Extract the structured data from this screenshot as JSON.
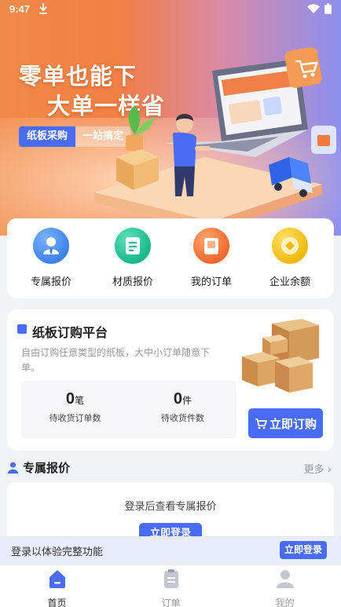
{
  "status_bar": {
    "time": "9:47"
  },
  "banner": {
    "slogan_line1": "零单也能下",
    "slogan_line2": "大单一样省",
    "tag_primary": "纸板采购",
    "tag_secondary": "一站搞定"
  },
  "quick_menu": [
    {
      "label": "专属报价",
      "icon": "user-badge-icon",
      "color": "#3f82ee"
    },
    {
      "label": "材质报价",
      "icon": "document-icon",
      "color": "#19b88a"
    },
    {
      "label": "我的订单",
      "icon": "order-icon",
      "color": "#f2692e"
    },
    {
      "label": "企业余额",
      "icon": "coin-icon",
      "color": "#f2b90c"
    }
  ],
  "platform": {
    "title": "纸板订购平台",
    "description": "自由订购任意类型的纸板，大中小订单随意下单。",
    "stats": [
      {
        "value": "0",
        "unit": "笔",
        "label": "待收货订单数"
      },
      {
        "value": "0",
        "unit": "件",
        "label": "待收货件数"
      }
    ],
    "order_button": "立即订购"
  },
  "exclusive_quote": {
    "title": "专属报价",
    "more": "更多",
    "hint": "登录后查看专属报价",
    "login_button": "立即登录"
  },
  "login_bar": {
    "text": "登录以体验完整功能",
    "button": "立即登录"
  },
  "tab_bar": [
    {
      "label": "首页",
      "icon": "home-icon",
      "active": true
    },
    {
      "label": "订单",
      "icon": "clipboard-icon",
      "active": false
    },
    {
      "label": "我的",
      "icon": "person-icon",
      "active": false
    }
  ],
  "colors": {
    "accent": "#4a6cf4",
    "hero_orange": "#f27f45",
    "hero_purple": "#8d8ff0"
  }
}
